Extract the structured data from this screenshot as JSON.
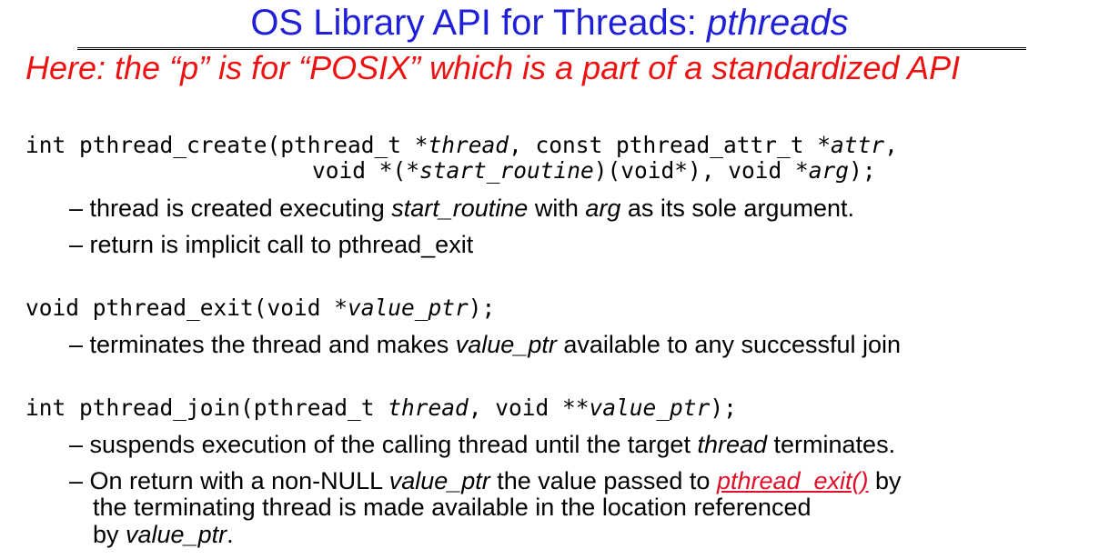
{
  "colors": {
    "title": "#1f1fd8",
    "subtitle": "#ee1111",
    "link": "#e0102a",
    "text": "#000000"
  },
  "title": {
    "plain": "OS Library API for Threads: ",
    "italic": "pthreads"
  },
  "subtitle": "Here: the “p” is for “POSIX” which is a part of a standardized API",
  "create": {
    "line1": {
      "a": "int pthread_create(pthread_t *",
      "b": "thread",
      "c": ", const pthread_attr_t *",
      "d": "attr",
      "e": ","
    },
    "line2": {
      "a": "void *(*",
      "b": "start_routine",
      "c": ")(void*), void *",
      "d": "arg",
      "e": ");"
    },
    "bullet1": {
      "a": "– thread is created executing ",
      "b": "start_routine",
      "c": " with ",
      "d": "arg",
      "e": " as its sole argument."
    },
    "bullet2": "– return is implicit call to pthread_exit"
  },
  "exit": {
    "sig": {
      "a": "void pthread_exit(void *",
      "b": "value_ptr",
      "c": ");"
    },
    "bullet1": {
      "a": "– terminates the thread and makes ",
      "b": "value_ptr",
      "c": " available to any successful join"
    }
  },
  "join": {
    "sig": {
      "a": "int pthread_join(pthread_t ",
      "b": "thread",
      "c": ", void **",
      "d": "value_ptr",
      "e": ");"
    },
    "bullet1": {
      "a": "– suspends execution of the calling thread until the target ",
      "b": "thread",
      "c": " terminates."
    },
    "bullet2": {
      "a": "– On return with a non-NULL ",
      "b": "value_ptr",
      "c": "  the value passed to ",
      "link": "pthread_exit()",
      "d": " by",
      "line2": "the terminating thread is made available in the location referenced",
      "line3a": "by ",
      "line3b": "value_ptr",
      "line3c": "."
    }
  }
}
